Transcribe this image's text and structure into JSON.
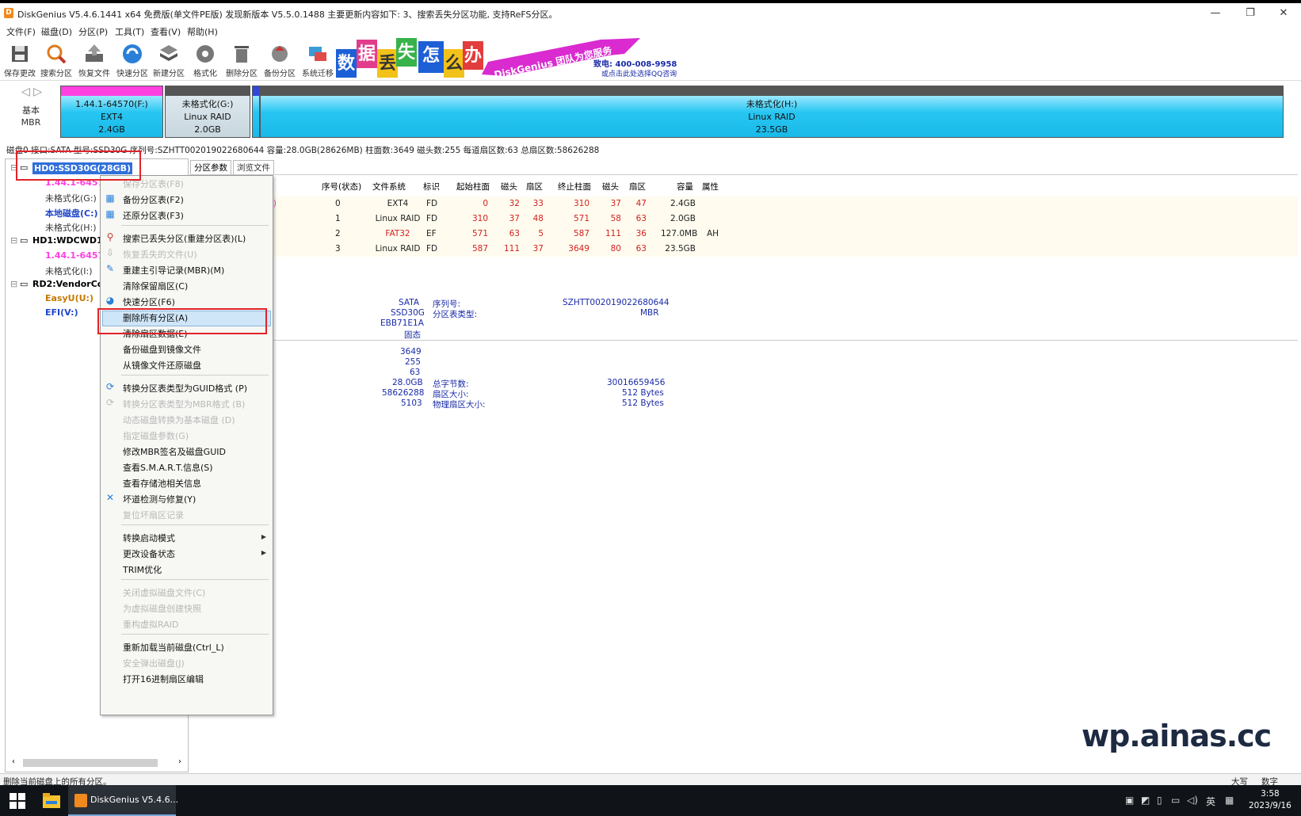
{
  "window": {
    "title": "DiskGenius V5.4.6.1441 x64 免费版(单文件PE版)   发现新版本 V5.5.0.1488   主要更新内容如下: 3、搜索丢失分区功能, 支持ReFS分区。",
    "minimize": "—",
    "restore": "❐",
    "close": "✕"
  },
  "menubar": [
    "文件(F)",
    "磁盘(D)",
    "分区(P)",
    "工具(T)",
    "查看(V)",
    "帮助(H)"
  ],
  "toolbar": [
    "保存更改",
    "搜索分区",
    "恢复文件",
    "快速分区",
    "新建分区",
    "格式化",
    "删除分区",
    "备份分区",
    "系统迁移"
  ],
  "banner": {
    "chars": [
      "数",
      "据",
      "丢",
      "失",
      "怎",
      "么",
      "办"
    ],
    "slogan": "DiskGenius 团队为您服务",
    "phone": "致电: 400-008-9958",
    "qq": "或点击此处选择QQ咨询"
  },
  "diskmap": {
    "nav": "◁ ▷",
    "type": "基本",
    "scheme": "MBR",
    "partitions": [
      {
        "name": "1.44.1-64570(F:)",
        "fs": "EXT4",
        "size": "2.4GB"
      },
      {
        "name": "未格式化(G:)",
        "fs": "Linux RAID",
        "size": "2.0GB"
      },
      {
        "name": "未格式化(H:)",
        "fs": "Linux RAID",
        "size": "23.5GB"
      }
    ]
  },
  "diskinfo": "磁盘0 接口:SATA  型号:SSD30G  序列号:SZHTT002019022680644  容量:28.0GB(28626MB)  柱面数:3649  磁头数:255  每道扇区数:63  总扇区数:58626288",
  "tree": {
    "nodes": [
      "HD0:SSD30G(28GB)",
      "1.44.1-6457",
      "未格式化(G:)",
      "本地磁盘(C:)",
      "未格式化(H:)",
      "HD1:WDCWD1(",
      "1.44.1-6457",
      "未格式化(I:)",
      "RD2:VendorCo",
      "EasyU(U:)",
      "EFI(V:)"
    ]
  },
  "tabs": [
    "分区参数",
    "浏览文件"
  ],
  "partition_table": {
    "headers": [
      "序号(状态)",
      "文件系统",
      "标识",
      "起始柱面",
      "磁头",
      "扇区",
      "终止柱面",
      "磁头",
      "扇区",
      "容量",
      "属性"
    ],
    "name_fragment": "(F:)",
    "rows": [
      [
        "0",
        "EXT4",
        "FD",
        "0",
        "32",
        "33",
        "310",
        "37",
        "47",
        "2.4GB",
        ""
      ],
      [
        "1",
        "Linux RAID",
        "FD",
        "310",
        "37",
        "48",
        "571",
        "58",
        "63",
        "2.0GB",
        ""
      ],
      [
        "2",
        "FAT32",
        "EF",
        "571",
        "63",
        "5",
        "587",
        "111",
        "36",
        "127.0MB",
        "AH"
      ],
      [
        "3",
        "Linux RAID",
        "FD",
        "587",
        "111",
        "37",
        "3649",
        "80",
        "63",
        "23.5GB",
        ""
      ]
    ]
  },
  "details": {
    "interface": "SATA",
    "model": "SSD30G",
    "id": "EBB71E1A",
    "media": "固态",
    "serial_label": "序列号:",
    "serial": "SZHTT002019022680644",
    "scheme_label": "分区表类型:",
    "scheme": "MBR",
    "cylinders": "3649",
    "heads": "255",
    "sectors": "63",
    "capacity": "28.0GB",
    "total_sectors": "58626288",
    "extra": "5103",
    "total_bytes_label": "总字节数:",
    "total_bytes": "30016659456",
    "sector_size_label": "扇区大小:",
    "sector_size": "512 Bytes",
    "phys_sector_label": "物理扇区大小:",
    "phys_sector": "512 Bytes"
  },
  "context_menu": [
    {
      "label": "保存分区表(F8)",
      "disabled": true
    },
    {
      "label": "备份分区表(F2)",
      "disabled": false
    },
    {
      "label": "还原分区表(F3)",
      "disabled": false
    },
    {
      "label": "搜索已丢失分区(重建分区表)(L)",
      "disabled": false
    },
    {
      "label": "恢复丢失的文件(U)",
      "disabled": true
    },
    {
      "label": "重建主引导记录(MBR)(M)",
      "disabled": false
    },
    {
      "label": "清除保留扇区(C)",
      "disabled": false
    },
    {
      "label": "快速分区(F6)",
      "disabled": false
    },
    {
      "label": "删除所有分区(A)",
      "disabled": false
    },
    {
      "label": "清除扇区数据(E)",
      "disabled": false
    },
    {
      "label": "备份磁盘到镜像文件",
      "disabled": false
    },
    {
      "label": "从镜像文件还原磁盘",
      "disabled": false
    },
    {
      "label": "转换分区表类型为GUID格式 (P)",
      "disabled": false
    },
    {
      "label": "转换分区表类型为MBR格式 (B)",
      "disabled": true
    },
    {
      "label": "动态磁盘转换为基本磁盘 (D)",
      "disabled": true
    },
    {
      "label": "指定磁盘参数(G)",
      "disabled": true
    },
    {
      "label": "修改MBR签名及磁盘GUID",
      "disabled": false
    },
    {
      "label": "查看S.M.A.R.T.信息(S)",
      "disabled": false
    },
    {
      "label": "查看存储池相关信息",
      "disabled": false
    },
    {
      "label": "坏道检测与修复(Y)",
      "disabled": false
    },
    {
      "label": "复位坏扇区记录",
      "disabled": true
    },
    {
      "label": "转换启动模式",
      "disabled": false
    },
    {
      "label": "更改设备状态",
      "disabled": false
    },
    {
      "label": "TRIM优化",
      "disabled": false
    },
    {
      "label": "关闭虚拟磁盘文件(C)",
      "disabled": true
    },
    {
      "label": "为虚拟磁盘创建快照",
      "disabled": true
    },
    {
      "label": "重构虚拟RAID",
      "disabled": true
    },
    {
      "label": "重新加载当前磁盘(Ctrl_L)",
      "disabled": false
    },
    {
      "label": "安全弹出磁盘(J)",
      "disabled": true
    },
    {
      "label": "打开16进制扇区编辑",
      "disabled": false
    }
  ],
  "watermark": "wp.ainas.cc",
  "statusbar": {
    "text": "删除当前磁盘上的所有分区。",
    "caps": "大写",
    "num": "数字"
  },
  "taskbar": {
    "app_label": "DiskGenius V5.4.6...",
    "ime": "英",
    "time": "3:58",
    "date": "2023/9/16"
  },
  "colors": {
    "selection": "#2f6fdb",
    "highlight_box": "#e0242a",
    "partition_ext4": "#ff3fe0",
    "partition_raid": "#19b9e8"
  }
}
